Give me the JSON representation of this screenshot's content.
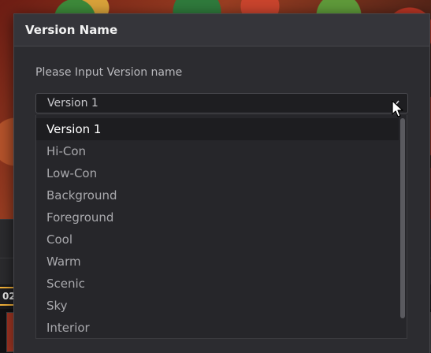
{
  "background": {
    "clip_badge": "02"
  },
  "dialog": {
    "title": "Version Name",
    "prompt": "Please Input Version name",
    "combo": {
      "value": "Version 1",
      "arrow_icon": "chevron-down-icon"
    },
    "dropdown": {
      "selected_index": 0,
      "options": [
        "Version 1",
        "Hi-Con",
        "Low-Con",
        "Background",
        "Foreground",
        "Cool",
        "Warm",
        "Scenic",
        "Sky",
        "Interior"
      ]
    }
  },
  "colors": {
    "dialog_bg": "#2c2c30",
    "header_bg": "#35353a",
    "dropdown_bg": "#26262a",
    "selected_option_bg": "#1d1d20",
    "badge_border": "#f4b23a"
  }
}
